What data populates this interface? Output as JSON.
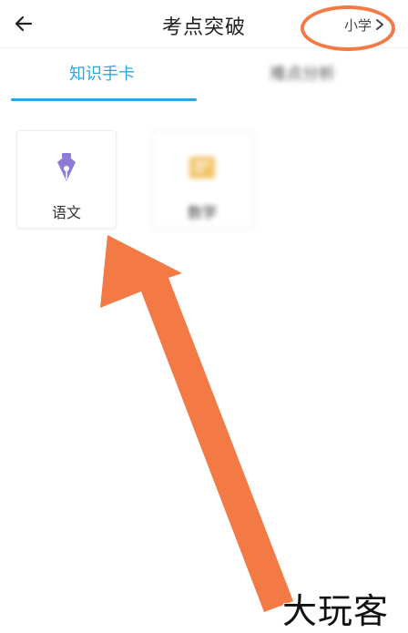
{
  "header": {
    "title": "考点突破",
    "grade": "小学"
  },
  "tabs": [
    {
      "label": "知识手卡",
      "active": true
    },
    {
      "label": "难点分析",
      "active": false
    }
  ],
  "subjects": [
    {
      "label": "语文",
      "icon": "fountain-pen-icon"
    },
    {
      "label": "数学",
      "icon": "math-book-icon"
    }
  ],
  "watermark": "大玩客",
  "colors": {
    "accent": "#29a8e0",
    "annotation": "#f47a45",
    "pen_icon": "#8d7bd6",
    "math_icon": "#f3c46a"
  }
}
